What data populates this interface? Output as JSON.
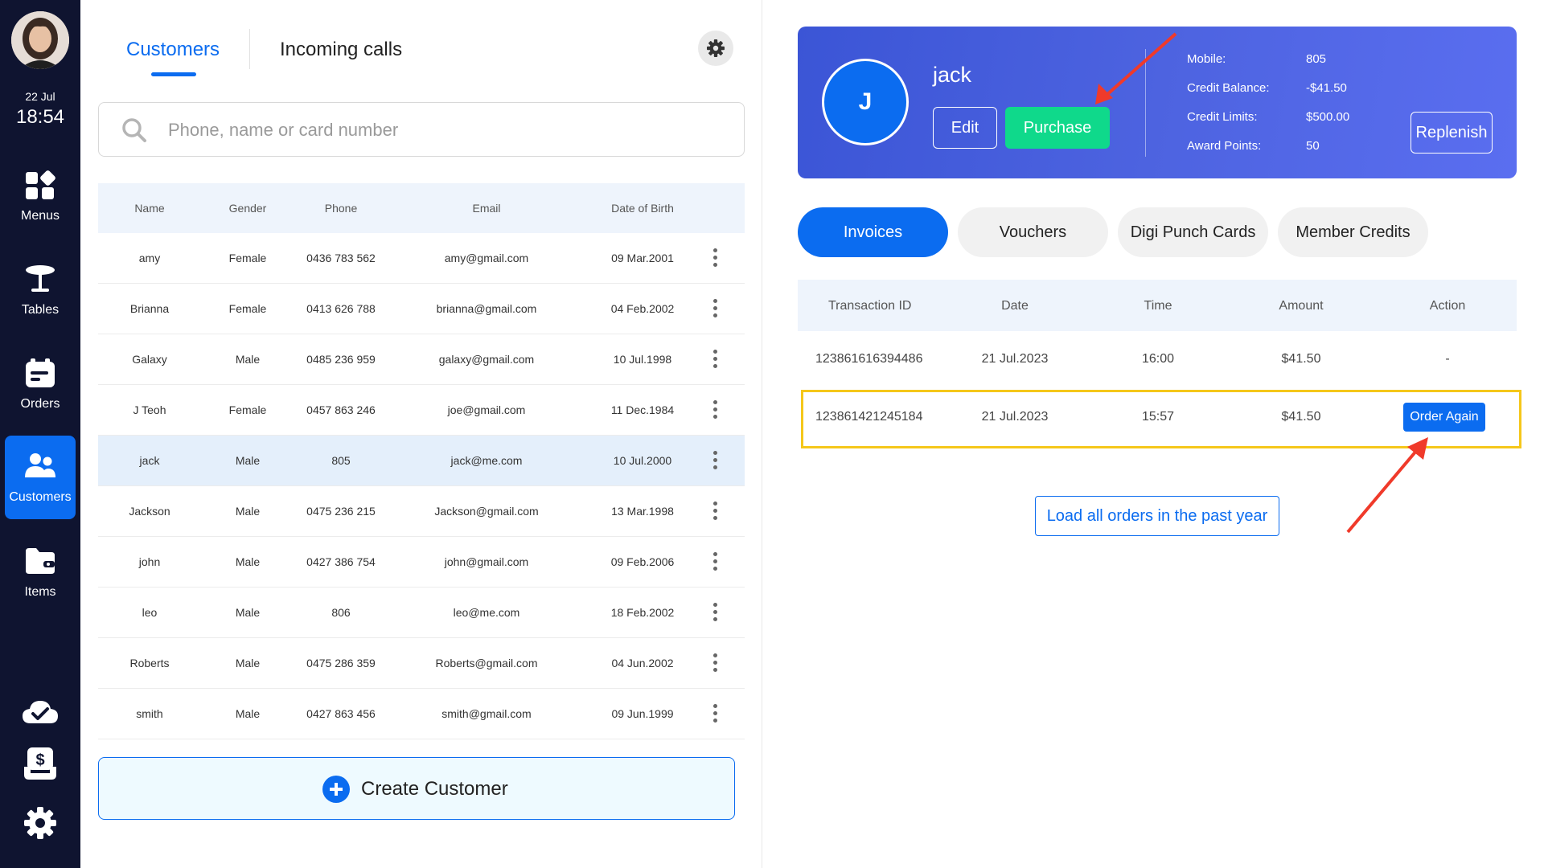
{
  "sidebar": {
    "date": "22 Jul",
    "time": "18:54",
    "items": [
      {
        "label": "Menus",
        "icon": "menus-icon"
      },
      {
        "label": "Tables",
        "icon": "table-icon"
      },
      {
        "label": "Orders",
        "icon": "orders-icon"
      },
      {
        "label": "Customers",
        "icon": "customers-icon",
        "active": true
      },
      {
        "label": "Items",
        "icon": "items-icon"
      }
    ],
    "bottom_icons": [
      "cloud-check-icon",
      "cash-drawer-icon",
      "gear-icon"
    ]
  },
  "left": {
    "tabs": [
      "Customers",
      "Incoming calls"
    ],
    "active_tab": "Customers",
    "search_placeholder": "Phone, name or card number",
    "columns": [
      "Name",
      "Gender",
      "Phone",
      "Email",
      "Date of Birth"
    ],
    "rows": [
      {
        "name": "amy",
        "gender": "Female",
        "phone": "0436 783 562",
        "email": "amy@gmail.com",
        "dob": "09 Mar.2001"
      },
      {
        "name": "Brianna",
        "gender": "Female",
        "phone": "0413 626 788",
        "email": "brianna@gmail.com",
        "dob": "04 Feb.2002"
      },
      {
        "name": "Galaxy",
        "gender": "Male",
        "phone": "0485 236 959",
        "email": "galaxy@gmail.com",
        "dob": "10 Jul.1998"
      },
      {
        "name": "J Teoh",
        "gender": "Female",
        "phone": "0457 863 246",
        "email": "joe@gmail.com",
        "dob": "11 Dec.1984"
      },
      {
        "name": "jack",
        "gender": "Male",
        "phone": "805",
        "email": "jack@me.com",
        "dob": "10 Jul.2000"
      },
      {
        "name": "Jackson",
        "gender": "Male",
        "phone": "0475 236 215",
        "email": "Jackson@gmail.com",
        "dob": "13 Mar.1998"
      },
      {
        "name": "john",
        "gender": "Male",
        "phone": "0427 386 754",
        "email": "john@gmail.com",
        "dob": "09 Feb.2006"
      },
      {
        "name": "leo",
        "gender": "Male",
        "phone": "806",
        "email": "leo@me.com",
        "dob": "18 Feb.2002"
      },
      {
        "name": "Roberts",
        "gender": "Male",
        "phone": "0475 286 359",
        "email": "Roberts@gmail.com",
        "dob": "04 Jun.2002"
      },
      {
        "name": "smith",
        "gender": "Male",
        "phone": "0427 863 456",
        "email": "smith@gmail.com",
        "dob": "09 Jun.1999"
      }
    ],
    "selected_row": "jack",
    "create_label": "Create Customer"
  },
  "profile": {
    "initial": "J",
    "name": "jack",
    "edit_label": "Edit",
    "purchase_label": "Purchase",
    "info": [
      {
        "label": "Mobile:",
        "value": "805"
      },
      {
        "label": "Credit Balance:",
        "value": "-$41.50"
      },
      {
        "label": "Credit Limits:",
        "value": "$500.00"
      },
      {
        "label": "Award Points:",
        "value": "50"
      }
    ],
    "replenish_label": "Replenish"
  },
  "right_tabs": [
    "Invoices",
    "Vouchers",
    "Digi Punch Cards",
    "Member Credits"
  ],
  "active_right_tab": "Invoices",
  "invoices": {
    "columns": [
      "Transaction ID",
      "Date",
      "Time",
      "Amount",
      "Action"
    ],
    "rows": [
      {
        "id": "123861616394486",
        "date": "21 Jul.2023",
        "time": "16:00",
        "amount": "$41.50",
        "action": "-"
      },
      {
        "id": "123861421245184",
        "date": "21 Jul.2023",
        "time": "15:57",
        "amount": "$41.50",
        "action": "Order Again"
      }
    ],
    "load_label": "Load all orders in the past year"
  },
  "colors": {
    "sidebar_bg": "#0f1430",
    "accent": "#0b6cf0",
    "purchase": "#0fd98b",
    "highlight": "#f5c71a",
    "annotation_arrow": "#f03a2a"
  }
}
